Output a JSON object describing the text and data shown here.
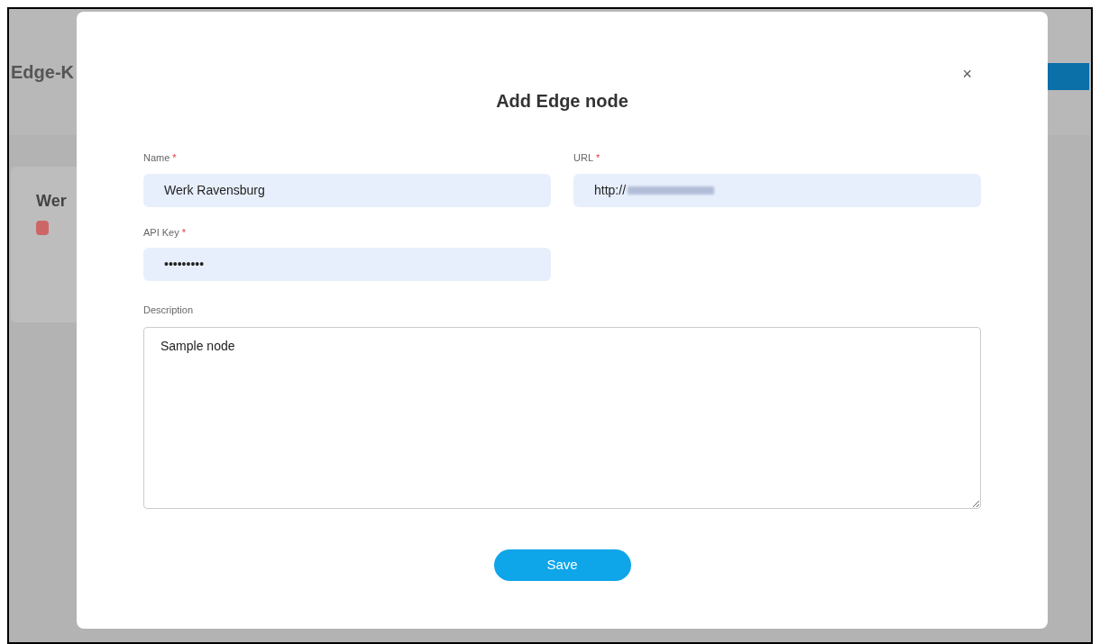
{
  "background": {
    "page_title": "Edge-K",
    "card_title": "Wer"
  },
  "dialog": {
    "title": "Add Edge node",
    "close": "×",
    "fields": [
      {
        "label": "Name",
        "required_mark": "*",
        "value": "Werk Ravensburg",
        "kind": "text"
      },
      {
        "label": "URL",
        "required_mark": "*",
        "value": "http://",
        "kind": "masked"
      },
      {
        "label": "API Key",
        "required_mark": "*",
        "value": "•••••••••",
        "kind": "text"
      }
    ],
    "description": {
      "label": "Description",
      "value": "Sample node"
    },
    "save": "Save"
  }
}
